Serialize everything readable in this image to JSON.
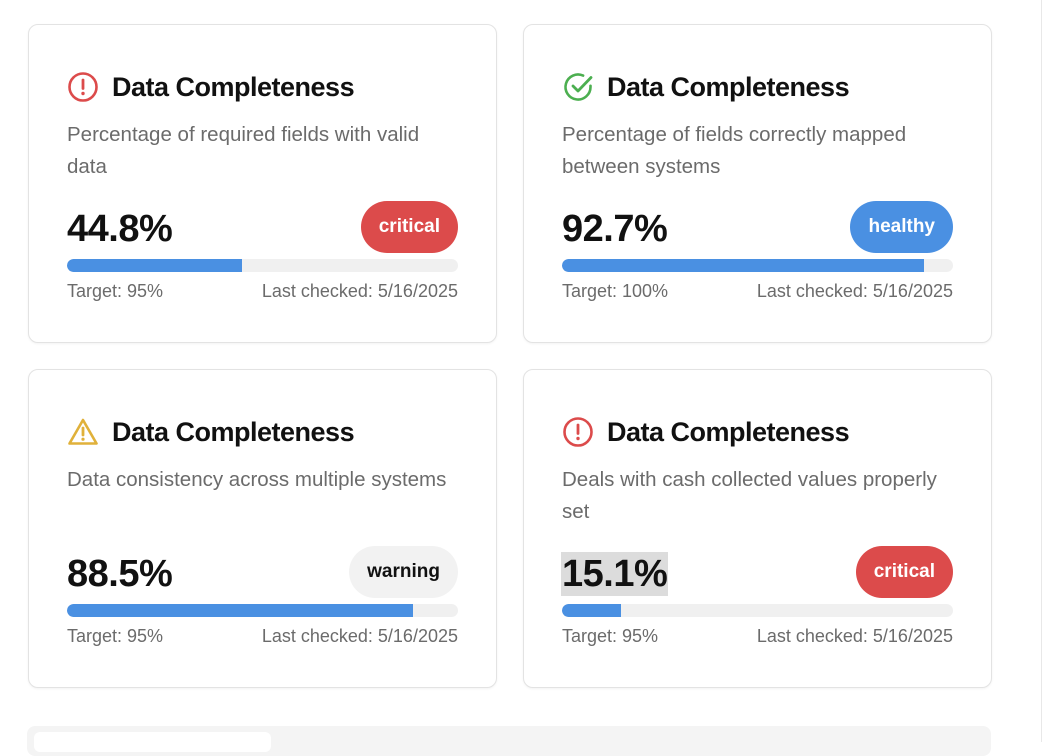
{
  "colors": {
    "progress": "#4a90e2",
    "critical": "#dc4b4b",
    "healthy": "#4a90e2",
    "warning_badge_bg": "#f2f2f2",
    "warning_icon": "#e0b13a",
    "success_icon": "#4caf50"
  },
  "cards": [
    {
      "title": "Data Completeness",
      "icon": "alert-circle-icon",
      "description": "Percentage of required fields with valid data",
      "value": "44.8%",
      "progress": 0.448,
      "status": "critical",
      "target": "Target: 95%",
      "last_checked": "Last checked: 5/16/2025"
    },
    {
      "title": "Data Completeness",
      "icon": "check-circle-icon",
      "description": "Percentage of fields correctly mapped between systems",
      "value": "92.7%",
      "progress": 0.927,
      "status": "healthy",
      "target": "Target: 100%",
      "last_checked": "Last checked: 5/16/2025"
    },
    {
      "title": "Data Completeness",
      "icon": "warning-triangle-icon",
      "description": "Data consistency across multiple systems",
      "value": "88.5%",
      "progress": 0.885,
      "status": "warning",
      "target": "Target: 95%",
      "last_checked": "Last checked: 5/16/2025"
    },
    {
      "title": "Data Completeness",
      "icon": "alert-circle-icon",
      "description": "Deals with cash collected values properly set",
      "value": "15.1%",
      "progress": 0.151,
      "status": "critical",
      "target": "Target: 95%",
      "last_checked": "Last checked: 5/16/2025"
    }
  ]
}
